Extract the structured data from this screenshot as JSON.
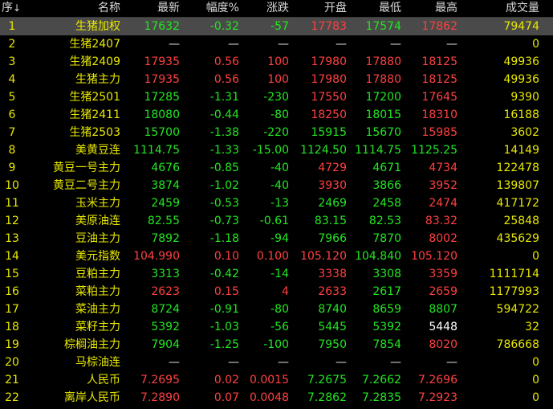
{
  "headers": {
    "seq": "序",
    "seq_arrow": "↓",
    "name": "名称",
    "last": "最新",
    "chgp": "幅度%",
    "chg": "涨跌",
    "open": "开盘",
    "low": "最低",
    "high": "最高",
    "vol": "成交量"
  },
  "colors": {
    "up": "#ff4040",
    "down": "#22e622",
    "flat": "#ffffff",
    "name": "#e8e800",
    "selected_row_bg": "#4a4a4a"
  },
  "selected_row": 1,
  "rows": [
    {
      "seq": "1",
      "name": "生猪加权",
      "last": "17632",
      "chgp": "-0.32",
      "chg": "-57",
      "open": "17783",
      "low": "17574",
      "high": "17862",
      "vol": "79474",
      "dir": "dn",
      "open_dir": "up",
      "low_dir": "dn",
      "high_dir": "up"
    },
    {
      "seq": "2",
      "name": "生猪2407",
      "last": "—",
      "chgp": "—",
      "chg": "—",
      "open": "—",
      "low": "—",
      "high": "—",
      "vol": "0",
      "dir": "dash",
      "open_dir": "dash",
      "low_dir": "dash",
      "high_dir": "dash"
    },
    {
      "seq": "3",
      "name": "生猪2409",
      "last": "17935",
      "chgp": "0.56",
      "chg": "100",
      "open": "17980",
      "low": "17880",
      "high": "18125",
      "vol": "49936",
      "dir": "up",
      "open_dir": "up",
      "low_dir": "up",
      "high_dir": "up"
    },
    {
      "seq": "4",
      "name": "生猪主力",
      "last": "17935",
      "chgp": "0.56",
      "chg": "100",
      "open": "17980",
      "low": "17880",
      "high": "18125",
      "vol": "49936",
      "dir": "up",
      "open_dir": "up",
      "low_dir": "up",
      "high_dir": "up"
    },
    {
      "seq": "5",
      "name": "生猪2501",
      "last": "17285",
      "chgp": "-1.31",
      "chg": "-230",
      "open": "17550",
      "low": "17200",
      "high": "17645",
      "vol": "9390",
      "dir": "dn",
      "open_dir": "up",
      "low_dir": "dn",
      "high_dir": "up"
    },
    {
      "seq": "6",
      "name": "生猪2411",
      "last": "18080",
      "chgp": "-0.44",
      "chg": "-80",
      "open": "18250",
      "low": "18015",
      "high": "18310",
      "vol": "16188",
      "dir": "dn",
      "open_dir": "up",
      "low_dir": "dn",
      "high_dir": "up"
    },
    {
      "seq": "7",
      "name": "生猪2503",
      "last": "15700",
      "chgp": "-1.38",
      "chg": "-220",
      "open": "15915",
      "low": "15670",
      "high": "15985",
      "vol": "3602",
      "dir": "dn",
      "open_dir": "dn",
      "low_dir": "dn",
      "high_dir": "up"
    },
    {
      "seq": "8",
      "name": "美黄豆连",
      "last": "1114.75",
      "chgp": "-1.33",
      "chg": "-15.00",
      "open": "1124.50",
      "low": "1114.75",
      "high": "1125.25",
      "vol": "14149",
      "dir": "dn",
      "open_dir": "dn",
      "low_dir": "dn",
      "high_dir": "dn"
    },
    {
      "seq": "9",
      "name": "黄豆一号主力",
      "last": "4676",
      "chgp": "-0.85",
      "chg": "-40",
      "open": "4729",
      "low": "4671",
      "high": "4734",
      "vol": "122478",
      "dir": "dn",
      "open_dir": "up",
      "low_dir": "dn",
      "high_dir": "up"
    },
    {
      "seq": "10",
      "name": "黄豆二号主力",
      "last": "3874",
      "chgp": "-1.02",
      "chg": "-40",
      "open": "3930",
      "low": "3866",
      "high": "3952",
      "vol": "139807",
      "dir": "dn",
      "open_dir": "up",
      "low_dir": "dn",
      "high_dir": "up"
    },
    {
      "seq": "11",
      "name": "玉米主力",
      "last": "2459",
      "chgp": "-0.53",
      "chg": "-13",
      "open": "2469",
      "low": "2458",
      "high": "2474",
      "vol": "417172",
      "dir": "dn",
      "open_dir": "dn",
      "low_dir": "dn",
      "high_dir": "up"
    },
    {
      "seq": "12",
      "name": "美原油连",
      "last": "82.55",
      "chgp": "-0.73",
      "chg": "-0.61",
      "open": "83.15",
      "low": "82.53",
      "high": "83.32",
      "vol": "25848",
      "dir": "dn",
      "open_dir": "dn",
      "low_dir": "dn",
      "high_dir": "up"
    },
    {
      "seq": "13",
      "name": "豆油主力",
      "last": "7892",
      "chgp": "-1.18",
      "chg": "-94",
      "open": "7966",
      "low": "7870",
      "high": "8002",
      "vol": "435629",
      "dir": "dn",
      "open_dir": "dn",
      "low_dir": "dn",
      "high_dir": "up"
    },
    {
      "seq": "14",
      "name": "美元指数",
      "last": "104.990",
      "chgp": "0.10",
      "chg": "0.100",
      "open": "105.120",
      "low": "104.840",
      "high": "105.120",
      "vol": "0",
      "dir": "up",
      "open_dir": "up",
      "low_dir": "dn",
      "high_dir": "up"
    },
    {
      "seq": "15",
      "name": "豆粕主力",
      "last": "3313",
      "chgp": "-0.42",
      "chg": "-14",
      "open": "3338",
      "low": "3308",
      "high": "3359",
      "vol": "1111714",
      "dir": "dn",
      "open_dir": "up",
      "low_dir": "dn",
      "high_dir": "up"
    },
    {
      "seq": "16",
      "name": "菜粕主力",
      "last": "2623",
      "chgp": "0.15",
      "chg": "4",
      "open": "2633",
      "low": "2617",
      "high": "2659",
      "vol": "1177993",
      "dir": "up",
      "open_dir": "up",
      "low_dir": "dn",
      "high_dir": "up"
    },
    {
      "seq": "17",
      "name": "菜油主力",
      "last": "8724",
      "chgp": "-0.91",
      "chg": "-80",
      "open": "8740",
      "low": "8659",
      "high": "8807",
      "vol": "594722",
      "dir": "dn",
      "open_dir": "dn",
      "low_dir": "dn",
      "high_dir": "dn"
    },
    {
      "seq": "18",
      "name": "菜籽主力",
      "last": "5392",
      "chgp": "-1.03",
      "chg": "-56",
      "open": "5445",
      "low": "5392",
      "high": "5448",
      "vol": "32",
      "dir": "dn",
      "open_dir": "dn",
      "low_dir": "dn",
      "high_dir": "eq"
    },
    {
      "seq": "19",
      "name": "棕榈油主力",
      "last": "7904",
      "chgp": "-1.25",
      "chg": "-100",
      "open": "7950",
      "low": "7854",
      "high": "8020",
      "vol": "786668",
      "dir": "dn",
      "open_dir": "dn",
      "low_dir": "dn",
      "high_dir": "up"
    },
    {
      "seq": "20",
      "name": "马棕油连",
      "last": "—",
      "chgp": "—",
      "chg": "—",
      "open": "—",
      "low": "—",
      "high": "—",
      "vol": "0",
      "dir": "dash",
      "open_dir": "dash",
      "low_dir": "dash",
      "high_dir": "dash"
    },
    {
      "seq": "21",
      "name": "人民币",
      "last": "7.2695",
      "chgp": "0.02",
      "chg": "0.0015",
      "open": "7.2675",
      "low": "7.2662",
      "high": "7.2696",
      "vol": "0",
      "dir": "up",
      "open_dir": "dn",
      "low_dir": "dn",
      "high_dir": "up"
    },
    {
      "seq": "22",
      "name": "离岸人民币",
      "last": "7.2890",
      "chgp": "0.07",
      "chg": "0.0048",
      "open": "7.2862",
      "low": "7.2835",
      "high": "7.2923",
      "vol": "0",
      "dir": "up",
      "open_dir": "dn",
      "low_dir": "dn",
      "high_dir": "up"
    }
  ]
}
